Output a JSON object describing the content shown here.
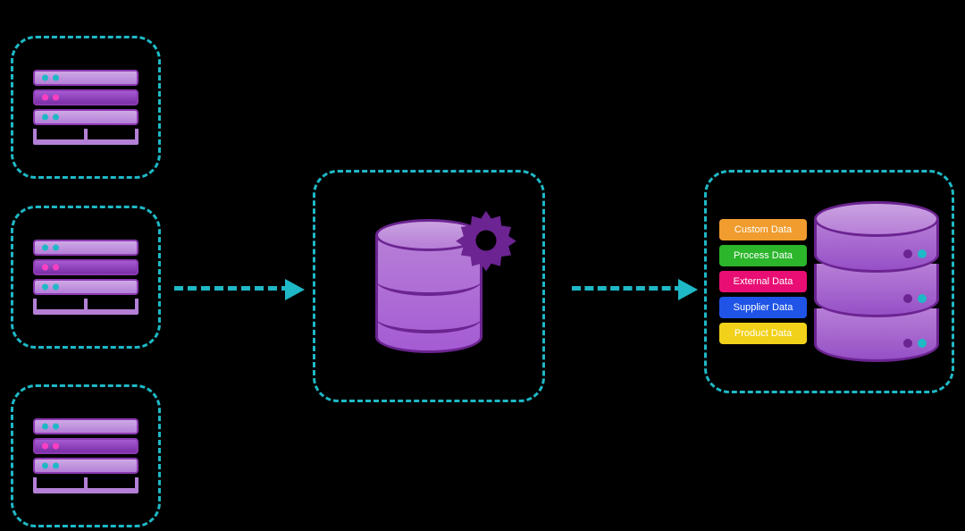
{
  "sources": {
    "count": 3,
    "icon_name": "server-rack-icon"
  },
  "processing": {
    "icon_name": "database-gear-icon"
  },
  "destination": {
    "icon_name": "database-icon",
    "data_labels": [
      "Custom Data",
      "Process Data",
      "External Data",
      "Supplier Data",
      "Product Data"
    ]
  },
  "arrows": [
    "sources-to-processing",
    "processing-to-destination"
  ],
  "colors": {
    "border": "#1fb8c6",
    "primary_purple": "#a55bd3",
    "label_colors": [
      "#f09c2e",
      "#2bb62b",
      "#e80e73",
      "#1f54e6",
      "#f2d11a"
    ]
  }
}
